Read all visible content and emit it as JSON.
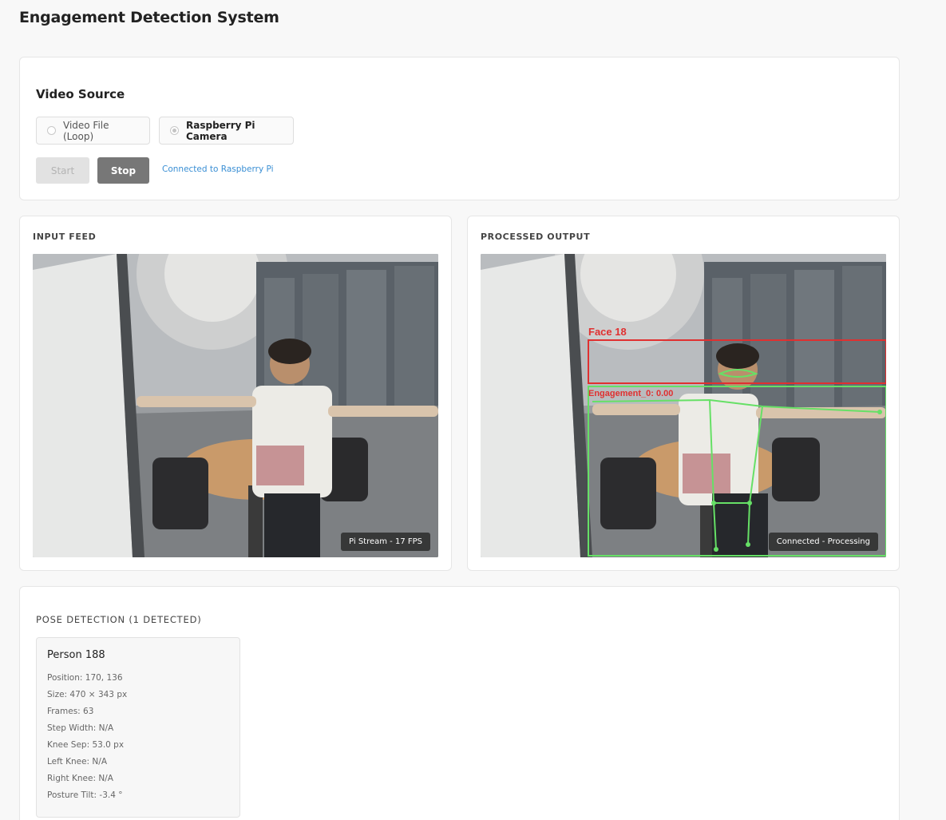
{
  "app": {
    "title": "Engagement Detection System"
  },
  "source": {
    "title": "Video Source",
    "options": [
      {
        "label": "Video File (Loop)",
        "selected": false
      },
      {
        "label": "Raspberry Pi Camera",
        "selected": true
      }
    ],
    "start_label": "Start",
    "stop_label": "Stop",
    "status": "Connected to Raspberry Pi"
  },
  "input_feed": {
    "label": "INPUT FEED",
    "badge": "Pi Stream - 17 FPS"
  },
  "output_feed": {
    "label": "PROCESSED OUTPUT",
    "badge": "Connected - Processing",
    "face_label": "Face 18",
    "engagement_label": "Engagement_0: 0.00"
  },
  "colors": {
    "status_link": "#3a8fd4",
    "face_box": "#e03030",
    "pose_box": "#66e066"
  },
  "pose": {
    "title": "POSE DETECTION (1 DETECTED)",
    "person": {
      "name": "Person 188",
      "position": "Position: 170, 136",
      "size": "Size: 470 × 343 px",
      "frames": "Frames: 63",
      "step_width": "Step Width: N/A",
      "knee_sep": "Knee Sep: 53.0 px",
      "left_knee": "Left Knee: N/A",
      "right_knee": "Right Knee: N/A",
      "posture_tilt": "Posture Tilt: -3.4 °"
    }
  }
}
